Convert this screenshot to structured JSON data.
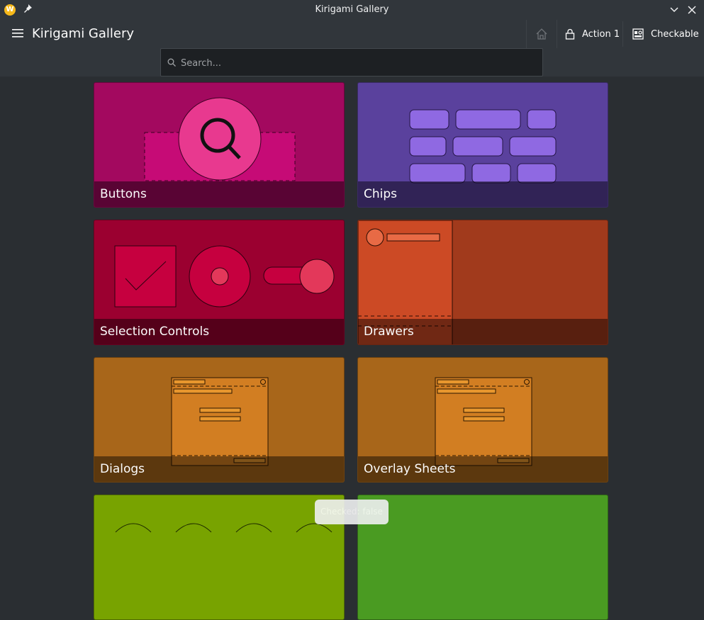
{
  "window": {
    "title": "Kirigami Gallery",
    "app_icon_letter": "W"
  },
  "toolbar": {
    "page_title": "Kirigami Gallery",
    "action1_label": "Action 1",
    "checkable_label": "Checkable"
  },
  "search": {
    "placeholder": "Search..."
  },
  "cards": [
    {
      "label": "Buttons",
      "color": "#a3095f"
    },
    {
      "label": "Chips",
      "color": "#5a419d"
    },
    {
      "label": "Selection Controls",
      "color": "#9b0030"
    },
    {
      "label": "Drawers",
      "color": "#a13a1c"
    },
    {
      "label": "Dialogs",
      "color": "#a8661a"
    },
    {
      "label": "Overlay Sheets",
      "color": "#a8661a"
    },
    {
      "label": "",
      "color": "#78a300"
    },
    {
      "label": "",
      "color": "#4a9b22"
    }
  ],
  "toast": {
    "text": "Checked: false"
  }
}
